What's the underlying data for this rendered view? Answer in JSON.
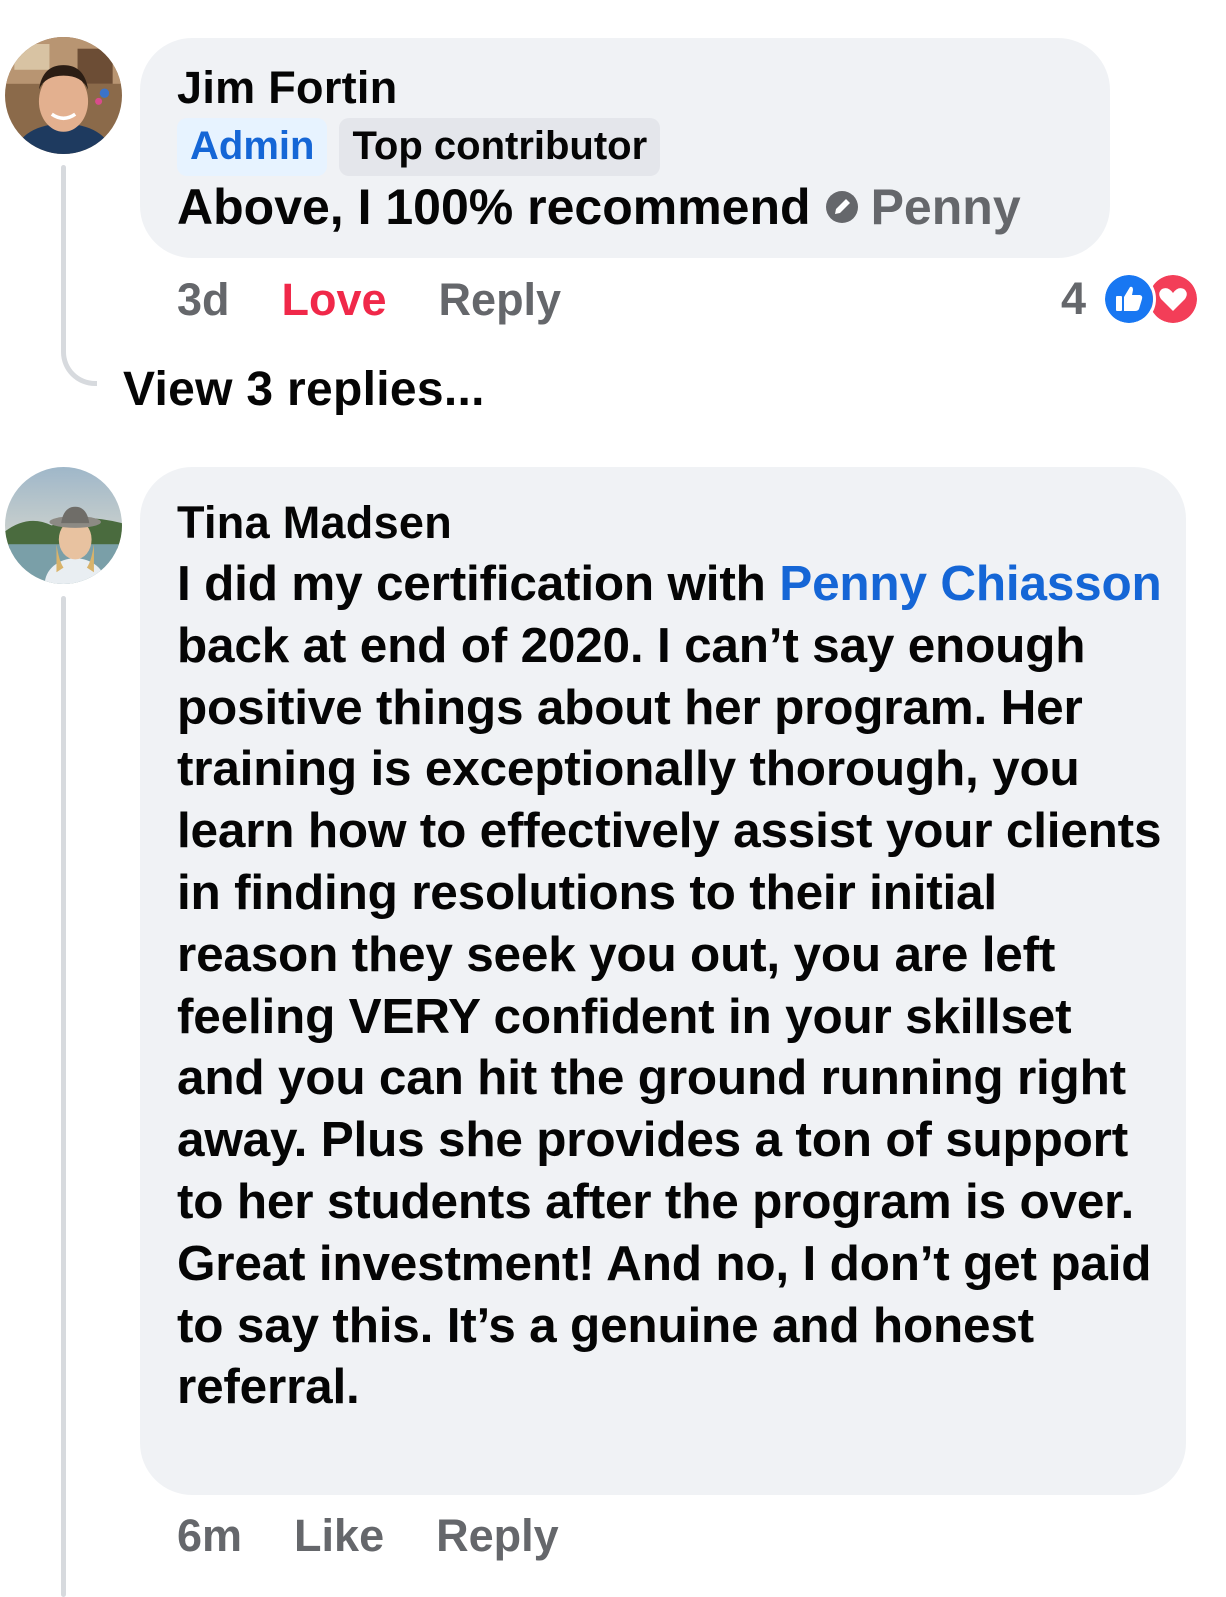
{
  "comments": [
    {
      "author": "Jim Fortin",
      "badges": [
        "Admin",
        "Top contributor"
      ],
      "text": "Above, I 100% recommend",
      "tag": "Penny",
      "time": "3d",
      "reaction_given": "Love",
      "reply_label": "Reply",
      "reaction_count": "4",
      "reaction_icons": [
        "like-icon",
        "heart-icon"
      ],
      "view_replies": "View 3 replies..."
    },
    {
      "author": "Tina Madsen",
      "text_before": "I did my certification with",
      "mention": "Penny Chiasson",
      "text_after": "back at end of 2020. I can’t say enough positive things about her program. Her training is exceptionally thorough, you learn how to effectively assist your clients in finding resolutions to their initial reason they seek you out, you are left feeling VERY confident in your skillset and you can hit the ground running right away. Plus she provides a ton of support to her students after the program is over. Great investment! And no, I don’t get paid to say this. It’s a genuine and honest referral.",
      "time": "6m",
      "like_label": "Like",
      "reply_label": "Reply"
    }
  ],
  "colors": {
    "bubble": "#f0f2f5",
    "link": "#1566d6",
    "love": "#f02849",
    "muted": "#65676b"
  }
}
